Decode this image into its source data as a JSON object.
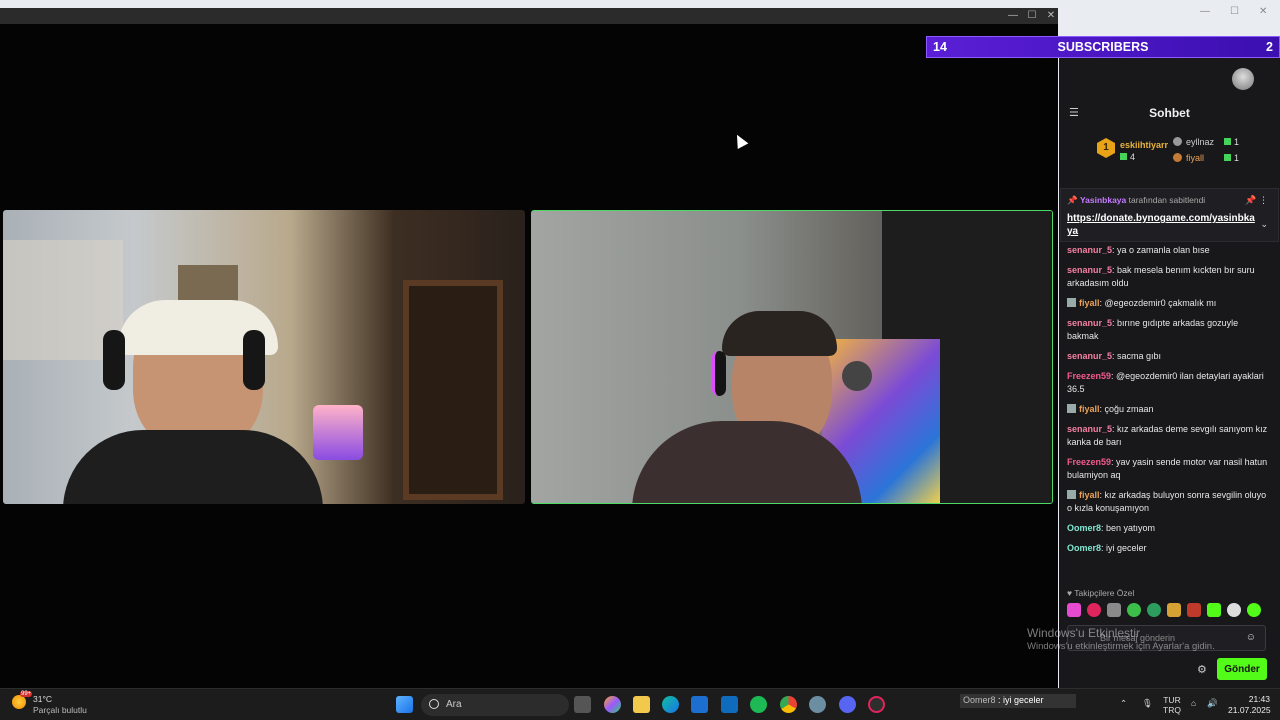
{
  "subscribers_bar": {
    "left_count": "14",
    "label": "SUBSCRIBERS",
    "right_count": "2"
  },
  "chat": {
    "title": "Sohbet",
    "leaderboard": [
      {
        "rank": "1",
        "name": "eskiihtiyarr",
        "value": "4"
      },
      {
        "name": "eyllnaz",
        "value": "1"
      },
      {
        "name": "fiyall",
        "value": "1"
      }
    ],
    "pinned": {
      "by_user": "Yasinbkaya",
      "by_text": " tarafından sabitlendi",
      "link": "https://donate.bynogame.com/yasinbkaya"
    },
    "messages": [
      {
        "user": "senanur_5",
        "color": "#f47fa2",
        "text": ": ya o zamanla olan bıse",
        "badge": false
      },
      {
        "user": "senanur_5",
        "color": "#f47fa2",
        "text": ": bak mesela benım kıckten bır suru arkadasım oldu",
        "badge": false
      },
      {
        "user": "fiyall",
        "color": "#e9a255",
        "text": ": @egeozdemir0 çakmalık mı",
        "badge": true
      },
      {
        "user": "senanur_5",
        "color": "#f47fa2",
        "text": ": bırıne gıdıpte arkadas gozuyle bakmak",
        "badge": false
      },
      {
        "user": "senanur_5",
        "color": "#f47fa2",
        "text": ": sacma gıbı",
        "badge": false
      },
      {
        "user": "Freezen59",
        "color": "#f45b8c",
        "text": ": @egeozdemir0 ilan detaylari ayaklari 36.5",
        "badge": false
      },
      {
        "user": "fiyall",
        "color": "#e9a255",
        "text": ": çoğu zmaan",
        "badge": true
      },
      {
        "user": "senanur_5",
        "color": "#f47fa2",
        "text": ": kız arkadas deme sevgılı sanıyom kız kanka de barı",
        "badge": false
      },
      {
        "user": "Freezen59",
        "color": "#f45b8c",
        "text": ": yav yasin sende motor var nasil hatun bulamiyon aq",
        "badge": false
      },
      {
        "user": "fiyall",
        "color": "#e9a255",
        "text": ": kız arkadaş buluyon sonra sevgilin oluyo o kızla konuşamıyon",
        "badge": true
      },
      {
        "user": "Oomer8",
        "color": "#7fe8d2",
        "text": ": ben yatıyom",
        "badge": false
      },
      {
        "user": "Oomer8",
        "color": "#7fe8d2",
        "text": ": iyi geceler",
        "badge": false
      }
    ],
    "followers_label": "Takipçilere Özel",
    "input_placeholder": "Bir mesaj gönderin",
    "send_label": "Gönder"
  },
  "watermark": {
    "line1": "Windows'u Etkinleştir",
    "line2": "Windows'u etkinleştirmek için Ayarlar'a gidin."
  },
  "taskbar": {
    "weather_temp": "31°C",
    "weather_desc": "Parçalı bulutlu",
    "weather_badge": "99+",
    "search_placeholder": "Ara",
    "tray_notification_user": "Oomer8",
    "tray_notification_text": " : iyi geceler",
    "lang_top": "TUR",
    "lang_bottom": "TRQ",
    "time": "21:43",
    "date": "21.07.2025"
  },
  "colors": {
    "accent_green": "#53fc18",
    "subscriber_purple": "#5a1fd6",
    "chat_bg": "#18181b"
  }
}
